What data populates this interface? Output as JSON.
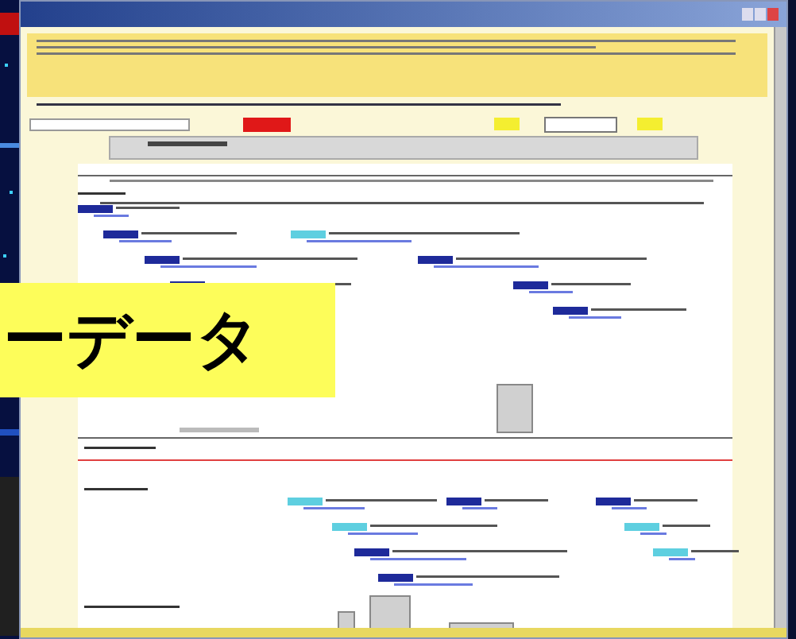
{
  "callout": {
    "text": "ーデータ"
  }
}
